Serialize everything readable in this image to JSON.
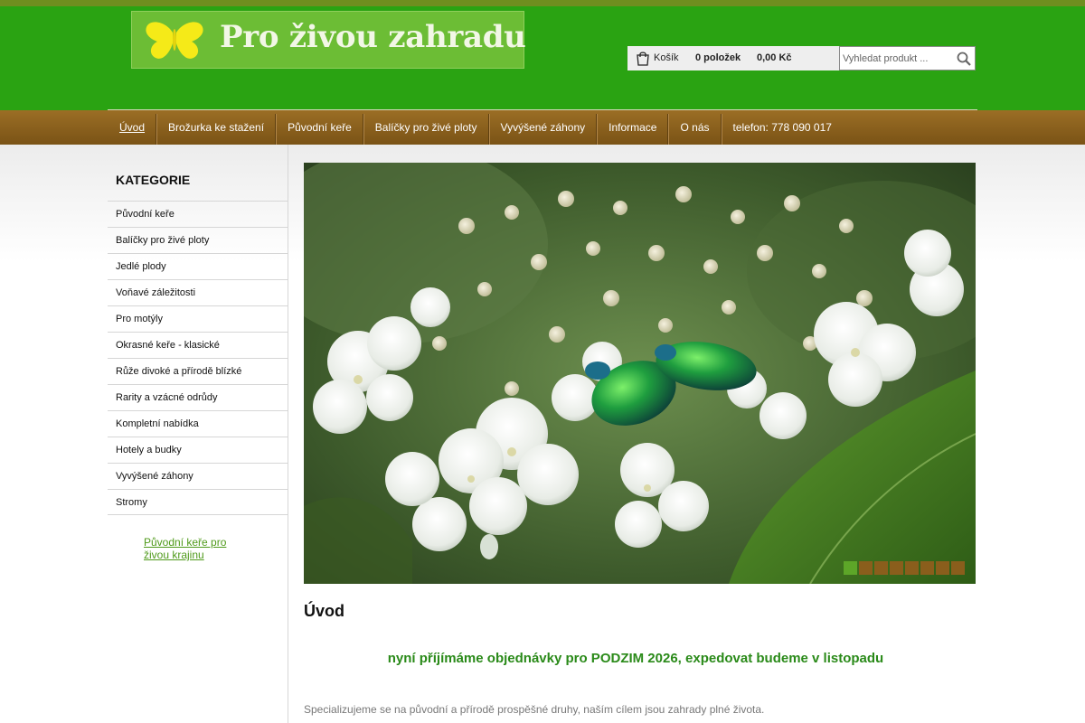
{
  "logo": {
    "text": "Pro živou zahradu"
  },
  "cart": {
    "label": "Košík",
    "items": "0 položek",
    "price": "0,00 Kč"
  },
  "search": {
    "placeholder": "Vyhledat produkt ..."
  },
  "nav": {
    "items": [
      {
        "label": "Úvod",
        "active": true
      },
      {
        "label": "Brožurka ke stažení"
      },
      {
        "label": "Původní keře"
      },
      {
        "label": "Balíčky pro živé ploty"
      },
      {
        "label": "Vyvýšené záhony"
      },
      {
        "label": "Informace"
      },
      {
        "label": "O nás"
      },
      {
        "label": "telefon: 778 090 017"
      }
    ]
  },
  "sidebar": {
    "title": "KATEGORIE",
    "items": [
      {
        "label": "Původní keře"
      },
      {
        "label": "Balíčky pro živé ploty"
      },
      {
        "label": "Jedlé plody"
      },
      {
        "label": "Voňavé záležitosti"
      },
      {
        "label": "Pro motýly"
      },
      {
        "label": "Okrasné keře - klasické"
      },
      {
        "label": "Růže divoké a přírodě blízké"
      },
      {
        "label": "Rarity a vzácné odrůdy"
      },
      {
        "label": "Kompletní nabídka"
      },
      {
        "label": "Hotely a budky"
      },
      {
        "label": "Vyvýšené záhony"
      },
      {
        "label": "Stromy"
      }
    ],
    "link": "Původní keře pro živou krajinu"
  },
  "slider": {
    "dot_count": 8,
    "active_index": 0
  },
  "content": {
    "title": "Úvod",
    "notice": "nyní příjímáme objednávky pro PODZIM 2026, expedovat budeme v listopadu",
    "intro": "Specializujeme se na původní a přírodě prospěšné druhy, naším cílem jsou zahrady plné života."
  },
  "colors": {
    "header_green": "#2aa312",
    "nav_brown": "#8a5e1c",
    "accent_green": "#5da628",
    "notice_green": "#2a8a19"
  },
  "icons": {
    "logo": "butterfly-icon",
    "cart": "shopping-bag-icon",
    "search": "magnifier-icon"
  }
}
